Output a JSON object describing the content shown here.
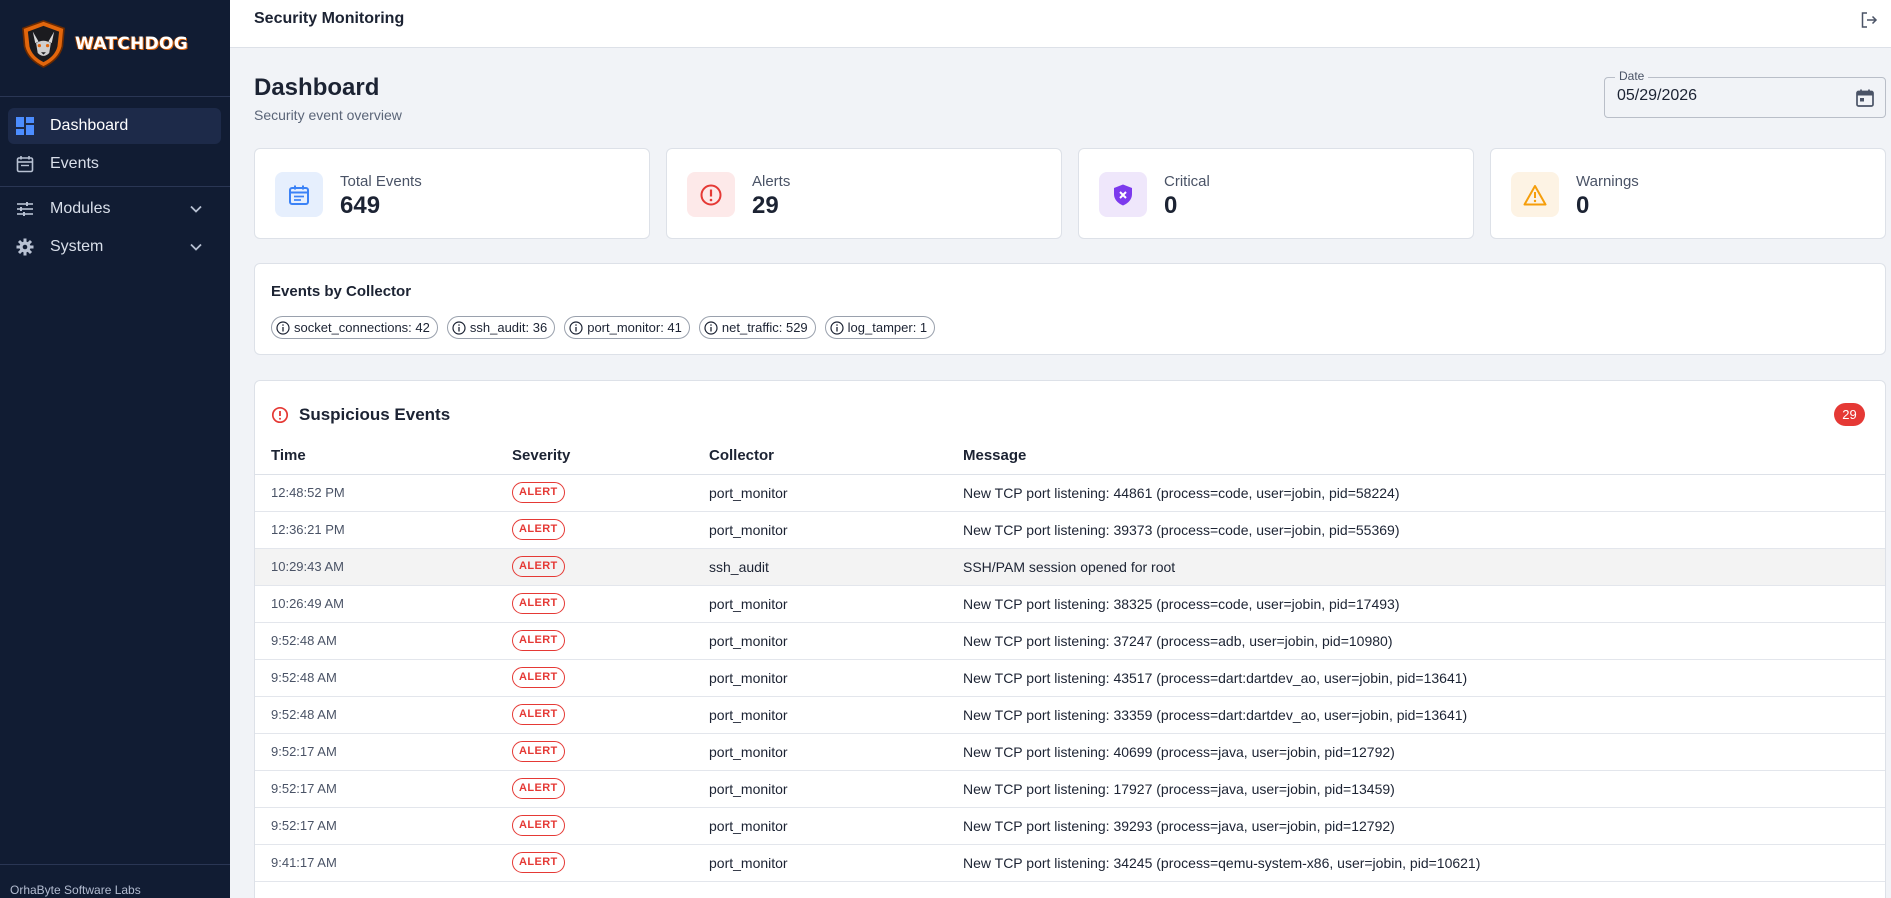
{
  "app": {
    "title": "Security Monitoring",
    "brand": "WATCHDOG",
    "footer": "OrhaByte Software Labs"
  },
  "sidebar": {
    "items": [
      {
        "label": "Dashboard",
        "icon": "dashboard-icon",
        "active": true
      },
      {
        "label": "Events",
        "icon": "calendar-icon"
      },
      {
        "label": "Modules",
        "icon": "sliders-icon",
        "expandable": true
      },
      {
        "label": "System",
        "icon": "gear-icon",
        "expandable": true
      }
    ]
  },
  "page": {
    "title": "Dashboard",
    "subtitle": "Security event overview"
  },
  "date_filter": {
    "label": "Date",
    "value": "05/29/2026"
  },
  "stats": [
    {
      "label": "Total Events",
      "value": "649",
      "icon": "calendar-icon",
      "color": "#3b82f6"
    },
    {
      "label": "Alerts",
      "value": "29",
      "icon": "alert-circle-icon",
      "color": "#e53935"
    },
    {
      "label": "Critical",
      "value": "0",
      "icon": "shield-x-icon",
      "color": "#7c3aed"
    },
    {
      "label": "Warnings",
      "value": "0",
      "icon": "warning-triangle-icon",
      "color": "#f59e0b"
    }
  ],
  "collectors": {
    "title": "Events by Collector",
    "chips": [
      "socket_connections: 42",
      "ssh_audit: 36",
      "port_monitor: 41",
      "net_traffic: 529",
      "log_tamper: 1"
    ]
  },
  "events": {
    "title": "Suspicious Events",
    "count": "29",
    "columns": [
      "Time",
      "Severity",
      "Collector",
      "Message"
    ],
    "rows": [
      {
        "time": "12:48:52 PM",
        "severity": "ALERT",
        "collector": "port_monitor",
        "message": "New TCP port listening: 44861 (process=code, user=jobin, pid=58224)"
      },
      {
        "time": "12:36:21 PM",
        "severity": "ALERT",
        "collector": "port_monitor",
        "message": "New TCP port listening: 39373 (process=code, user=jobin, pid=55369)"
      },
      {
        "time": "10:29:43 AM",
        "severity": "ALERT",
        "collector": "ssh_audit",
        "message": "SSH/PAM session opened for root"
      },
      {
        "time": "10:26:49 AM",
        "severity": "ALERT",
        "collector": "port_monitor",
        "message": "New TCP port listening: 38325 (process=code, user=jobin, pid=17493)"
      },
      {
        "time": "9:52:48 AM",
        "severity": "ALERT",
        "collector": "port_monitor",
        "message": "New TCP port listening: 37247 (process=adb, user=jobin, pid=10980)"
      },
      {
        "time": "9:52:48 AM",
        "severity": "ALERT",
        "collector": "port_monitor",
        "message": "New TCP port listening: 43517 (process=dart:dartdev_ao, user=jobin, pid=13641)"
      },
      {
        "time": "9:52:48 AM",
        "severity": "ALERT",
        "collector": "port_monitor",
        "message": "New TCP port listening: 33359 (process=dart:dartdev_ao, user=jobin, pid=13641)"
      },
      {
        "time": "9:52:17 AM",
        "severity": "ALERT",
        "collector": "port_monitor",
        "message": "New TCP port listening: 40699 (process=java, user=jobin, pid=12792)"
      },
      {
        "time": "9:52:17 AM",
        "severity": "ALERT",
        "collector": "port_monitor",
        "message": "New TCP port listening: 17927 (process=java, user=jobin, pid=13459)"
      },
      {
        "time": "9:52:17 AM",
        "severity": "ALERT",
        "collector": "port_monitor",
        "message": "New TCP port listening: 39293 (process=java, user=jobin, pid=12792)"
      },
      {
        "time": "9:41:17 AM",
        "severity": "ALERT",
        "collector": "port_monitor",
        "message": "New TCP port listening: 34245 (process=qemu-system-x86, user=jobin, pid=10621)"
      }
    ]
  },
  "colors": {
    "sidebar_bg": "#111c33",
    "accent": "#3b82f6",
    "alert": "#e53935"
  }
}
